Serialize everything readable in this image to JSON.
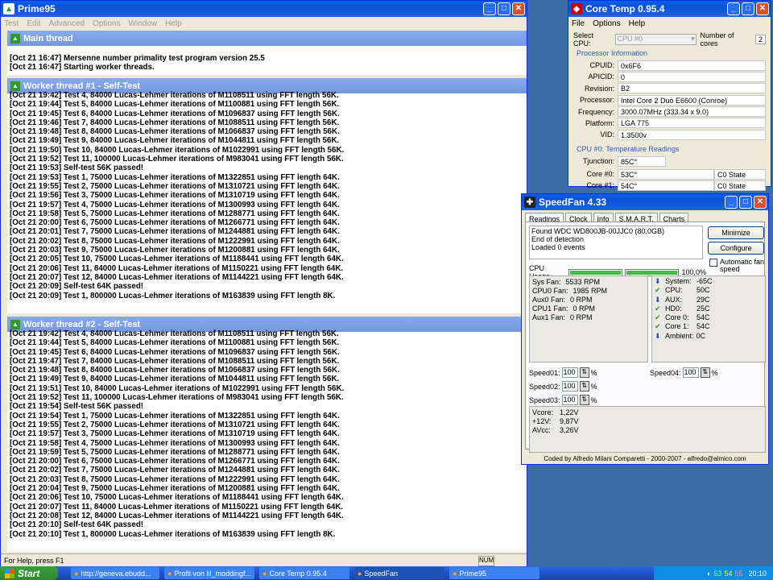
{
  "prime95": {
    "title": "Prime95",
    "menu": [
      "Test",
      "Edit",
      "Advanced",
      "Options",
      "Window",
      "Help"
    ],
    "main_thread": {
      "title": "Main thread",
      "lines": [
        "[Oct 21 16:47] Mersenne number primality test program version 25.5",
        "[Oct 21 16:47] Starting worker threads."
      ]
    },
    "worker1": {
      "title": "Worker thread #1 - Self-Test",
      "lines": [
        "[Oct 21 19:42] Test 4, 84000 Lucas-Lehmer iterations of M1108511 using FFT length 56K.",
        "[Oct 21 19:44] Test 5, 84000 Lucas-Lehmer iterations of M1100881 using FFT length 56K.",
        "[Oct 21 19:45] Test 6, 84000 Lucas-Lehmer iterations of M1096837 using FFT length 56K.",
        "[Oct 21 19:46] Test 7, 84000 Lucas-Lehmer iterations of M1088511 using FFT length 56K.",
        "[Oct 21 19:48] Test 8, 84000 Lucas-Lehmer iterations of M1066837 using FFT length 56K.",
        "[Oct 21 19:49] Test 9, 84000 Lucas-Lehmer iterations of M1044811 using FFT length 56K.",
        "[Oct 21 19:50] Test 10, 84000 Lucas-Lehmer iterations of M1022991 using FFT length 56K.",
        "[Oct 21 19:52] Test 11, 100000 Lucas-Lehmer iterations of M983041 using FFT length 56K.",
        "[Oct 21 19:53] Self-test 56K passed!",
        "[Oct 21 19:53] Test 1, 75000 Lucas-Lehmer iterations of M1322851 using FFT length 64K.",
        "[Oct 21 19:55] Test 2, 75000 Lucas-Lehmer iterations of M1310721 using FFT length 64K.",
        "[Oct 21 19:56] Test 3, 75000 Lucas-Lehmer iterations of M1310719 using FFT length 64K.",
        "[Oct 21 19:57] Test 4, 75000 Lucas-Lehmer iterations of M1300993 using FFT length 64K.",
        "[Oct 21 19:58] Test 5, 75000 Lucas-Lehmer iterations of M1288771 using FFT length 64K.",
        "[Oct 21 20:00] Test 6, 75000 Lucas-Lehmer iterations of M1266771 using FFT length 64K.",
        "[Oct 21 20:01] Test 7, 75000 Lucas-Lehmer iterations of M1244881 using FFT length 64K.",
        "[Oct 21 20:02] Test 8, 75000 Lucas-Lehmer iterations of M1222991 using FFT length 64K.",
        "[Oct 21 20:03] Test 9, 75000 Lucas-Lehmer iterations of M1200881 using FFT length 64K.",
        "[Oct 21 20:05] Test 10, 75000 Lucas-Lehmer iterations of M1188441 using FFT length 64K.",
        "[Oct 21 20:06] Test 11, 84000 Lucas-Lehmer iterations of M1150221 using FFT length 64K.",
        "[Oct 21 20:07] Test 12, 84000 Lucas-Lehmer iterations of M1144221 using FFT length 64K.",
        "[Oct 21 20:09] Self-test 64K passed!",
        "[Oct 21 20:09] Test 1, 800000 Lucas-Lehmer iterations of M163839 using FFT length 8K."
      ]
    },
    "worker2": {
      "title": "Worker thread #2 - Self-Test",
      "lines": [
        "[Oct 21 19:42] Test 4, 84000 Lucas-Lehmer iterations of M1108511 using FFT length 56K.",
        "[Oct 21 19:44] Test 5, 84000 Lucas-Lehmer iterations of M1100881 using FFT length 56K.",
        "[Oct 21 19:45] Test 6, 84000 Lucas-Lehmer iterations of M1096837 using FFT length 56K.",
        "[Oct 21 19:47] Test 7, 84000 Lucas-Lehmer iterations of M1088511 using FFT length 56K.",
        "[Oct 21 19:48] Test 8, 84000 Lucas-Lehmer iterations of M1066837 using FFT length 56K.",
        "[Oct 21 19:49] Test 9, 84000 Lucas-Lehmer iterations of M1044811 using FFT length 56K.",
        "[Oct 21 19:51] Test 10, 84000 Lucas-Lehmer iterations of M1022991 using FFT length 56K.",
        "[Oct 21 19:52] Test 11, 100000 Lucas-Lehmer iterations of M983041 using FFT length 56K.",
        "[Oct 21 19:54] Self-test 56K passed!",
        "[Oct 21 19:54] Test 1, 75000 Lucas-Lehmer iterations of M1322851 using FFT length 64K.",
        "[Oct 21 19:55] Test 2, 75000 Lucas-Lehmer iterations of M1310721 using FFT length 64K.",
        "[Oct 21 19:57] Test 3, 75000 Lucas-Lehmer iterations of M1310719 using FFT length 64K.",
        "[Oct 21 19:58] Test 4, 75000 Lucas-Lehmer iterations of M1300993 using FFT length 64K.",
        "[Oct 21 19:59] Test 5, 75000 Lucas-Lehmer iterations of M1288771 using FFT length 64K.",
        "[Oct 21 20:00] Test 6, 75000 Lucas-Lehmer iterations of M1266771 using FFT length 64K.",
        "[Oct 21 20:02] Test 7, 75000 Lucas-Lehmer iterations of M1244881 using FFT length 64K.",
        "[Oct 21 20:03] Test 8, 75000 Lucas-Lehmer iterations of M1222991 using FFT length 64K.",
        "[Oct 21 20:04] Test 9, 75000 Lucas-Lehmer iterations of M1200881 using FFT length 64K.",
        "[Oct 21 20:06] Test 10, 75000 Lucas-Lehmer iterations of M1188441 using FFT length 64K.",
        "[Oct 21 20:07] Test 11, 84000 Lucas-Lehmer iterations of M1150221 using FFT length 64K.",
        "[Oct 21 20:08] Test 12, 84000 Lucas-Lehmer iterations of M1144221 using FFT length 64K.",
        "[Oct 21 20:10] Self-test 64K passed!",
        "[Oct 21 20:10] Test 1, 800000 Lucas-Lehmer iterations of M163839 using FFT length 8K."
      ]
    },
    "status_text": "For Help, press F1",
    "status_num": "NUM"
  },
  "coretemp": {
    "title": "Core Temp 0.95.4",
    "menu": [
      "File",
      "Options",
      "Help"
    ],
    "select_cpu_label": "Select CPU:",
    "select_cpu_value": "CPU #0",
    "num_cores_label": "Number of cores",
    "num_cores_value": "2",
    "proc_info_title": "Processor Information",
    "proc_info": [
      {
        "label": "CPUID:",
        "value": "0x6F6"
      },
      {
        "label": "APICID:",
        "value": "0"
      },
      {
        "label": "Revision:",
        "value": "B2"
      },
      {
        "label": "Processor:",
        "value": "Intel Core 2 Duo E6600 (Conroe)"
      },
      {
        "label": "Frequency:",
        "value": "3000.07MHz (333.34 x 9.0)"
      },
      {
        "label": "Platform:",
        "value": "LGA 775"
      },
      {
        "label": "VID:",
        "value": "1.3500v"
      }
    ],
    "temp_title": "CPU #0: Temperature Readings",
    "tjunction_label": "Tjunction:",
    "tjunction_value": "85C°",
    "cores": [
      {
        "label": "Core #0:",
        "value": "53C°",
        "state": "C0 State"
      },
      {
        "label": "Core #1:",
        "value": "54C°",
        "state": "C0 State"
      }
    ]
  },
  "speedfan": {
    "title": "SpeedFan 4.33",
    "tabs": [
      "Readings",
      "Clock",
      "Info",
      "S.M.A.R.T.",
      "Charts"
    ],
    "log": [
      "Found WDC WD800JB-00JJC0 (80,0GB)",
      "End of detection",
      "Loaded 0 events"
    ],
    "minimize_label": "Minimize",
    "configure_label": "Configure",
    "auto_fan_label": "Automatic fan speed",
    "cpu_usage_label": "CPU Usage",
    "cpu_usage_value": "100,0%",
    "cpu_usage_fraction": 1.0,
    "fans": [
      {
        "label": "Sys Fan:",
        "value": "5533 RPM"
      },
      {
        "label": "CPU0 Fan:",
        "value": "1985 RPM"
      },
      {
        "label": "Aux0 Fan:",
        "value": "0 RPM"
      },
      {
        "label": "CPU1 Fan:",
        "value": "0 RPM"
      },
      {
        "label": "Aux1 Fan:",
        "value": "0 RPM"
      }
    ],
    "temps": [
      {
        "label": "System:",
        "value": "-65C",
        "icon": "arrow-down-icon"
      },
      {
        "label": "CPU:",
        "value": "50C",
        "icon": "check-icon"
      },
      {
        "label": "AUX:",
        "value": "29C",
        "icon": "arrow-down-icon"
      },
      {
        "label": "HD0:",
        "value": "25C",
        "icon": "check-icon"
      },
      {
        "label": "Core 0:",
        "value": "54C",
        "icon": "check-icon"
      },
      {
        "label": "Core 1:",
        "value": "54C",
        "icon": "check-icon"
      },
      {
        "label": "Ambient:",
        "value": "0C",
        "icon": "arrow-down-icon"
      }
    ],
    "speeds": [
      {
        "label": "Speed01:",
        "value": "100",
        "unit": "%"
      },
      {
        "label": "Speed02:",
        "value": "100",
        "unit": "%"
      },
      {
        "label": "Speed03:",
        "value": "100",
        "unit": "%"
      },
      {
        "label": "Speed04:",
        "value": "100",
        "unit": "%"
      }
    ],
    "voltages": [
      {
        "label": "Vcore:",
        "value": "1,22V"
      },
      {
        "label": "+12V:",
        "value": "9,87V"
      },
      {
        "label": "AVcc:",
        "value": "3,26V"
      }
    ],
    "footer": "Coded by Alfredo Milani Comparetti - 2000-2007 - alfredo@almico.com"
  },
  "taskbar": {
    "start_label": "Start",
    "tasks": [
      {
        "label": "http://geneva.ebudd...",
        "icon": "firefox-icon"
      },
      {
        "label": "Profil von lil_moddingf...",
        "icon": "firefox-icon"
      },
      {
        "label": "Core Temp 0.95.4",
        "icon": "coretemp-icon"
      },
      {
        "label": "SpeedFan",
        "icon": "speedfan-icon"
      },
      {
        "label": "Prime95",
        "icon": "prime95-icon"
      }
    ],
    "tray_temps": [
      "53",
      "54",
      "55"
    ],
    "clock": "20:10"
  }
}
